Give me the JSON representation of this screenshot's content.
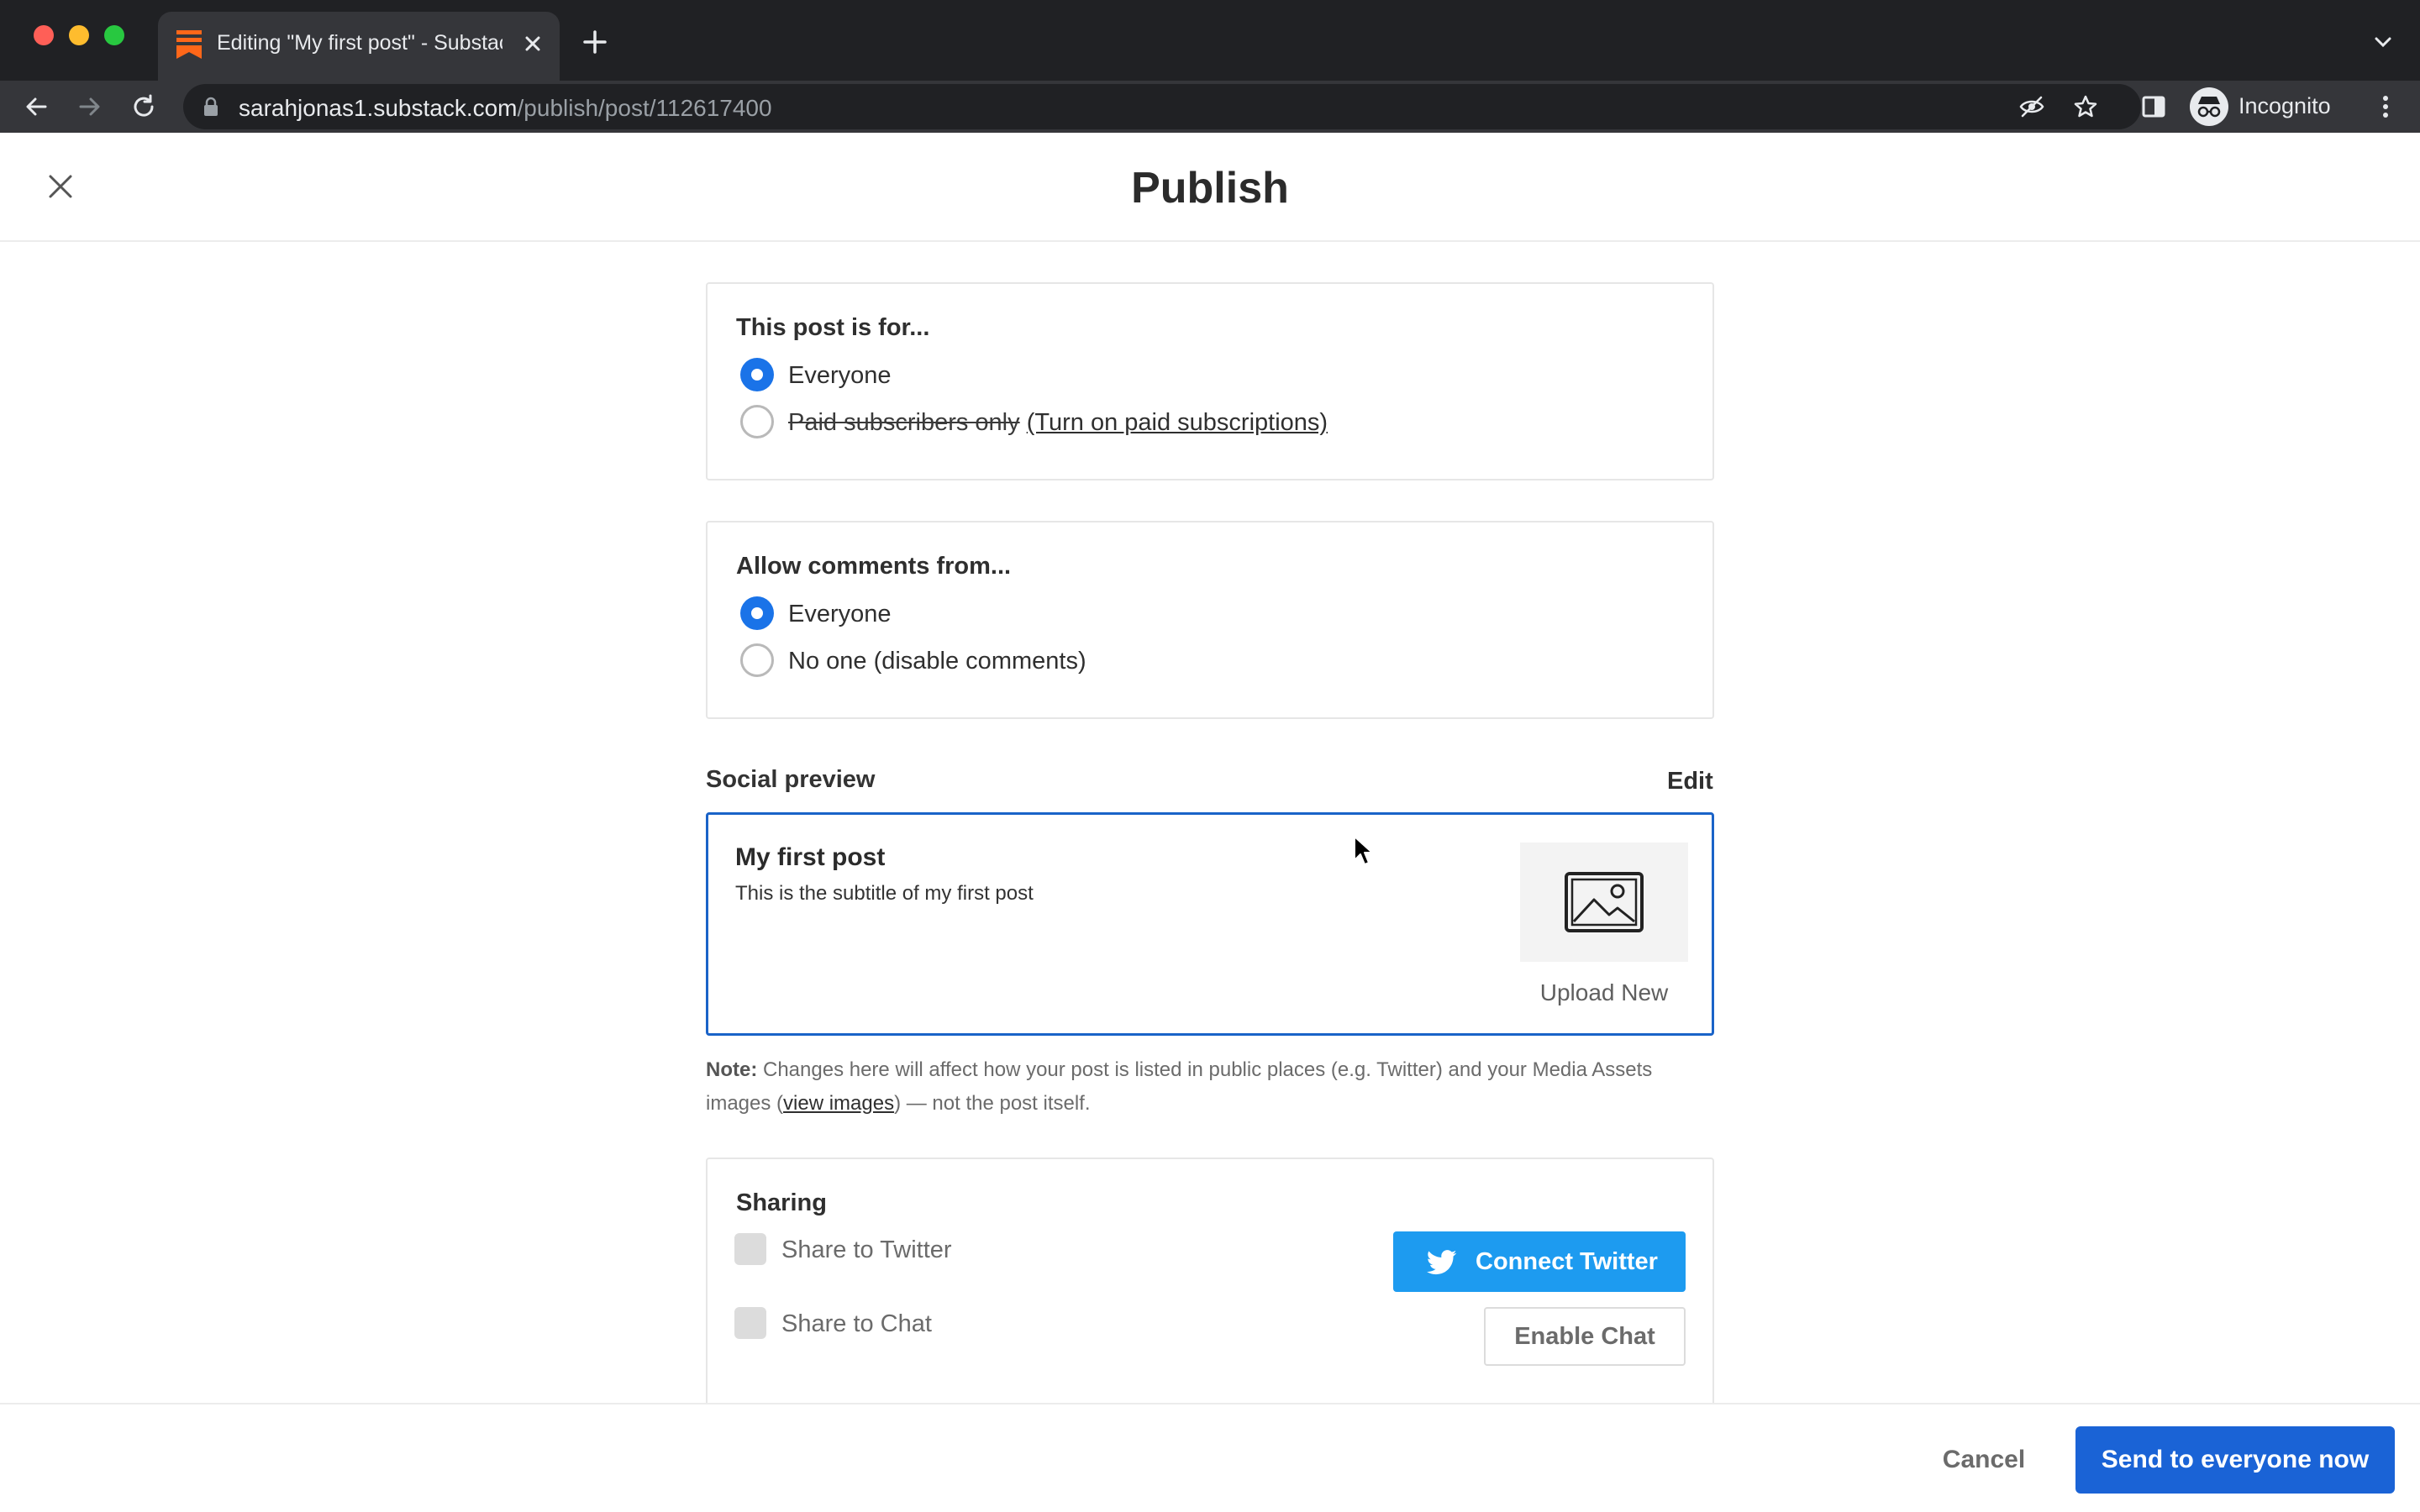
{
  "browser": {
    "tab_title": "Editing \"My first post\" - Substack",
    "url_host": "sarahjonas1.substack.com",
    "url_path": "/publish/post/112617400",
    "profile_label": "Incognito"
  },
  "header": {
    "title": "Publish"
  },
  "audience": {
    "label": "This post is for...",
    "options": [
      {
        "label": "Everyone",
        "selected": true
      },
      {
        "label": "Paid subscribers only",
        "link": "(Turn on paid subscriptions)",
        "selected": false
      }
    ]
  },
  "comments": {
    "label": "Allow comments from...",
    "options": [
      {
        "label": "Everyone",
        "selected": true
      },
      {
        "label": "No one (disable comments)",
        "selected": false
      }
    ]
  },
  "social_preview": {
    "section_title": "Social preview",
    "edit_label": "Edit",
    "post_title": "My first post",
    "post_subtitle": "This is the subtitle of my first post",
    "upload_label": "Upload New"
  },
  "note": {
    "prefix": "Note:",
    "text_before": " Changes here will affect how your post is listed in public places (e.g. Twitter) and your Media Assets images (",
    "link": "view images",
    "text_after": ") — not the post itself."
  },
  "sharing": {
    "title": "Sharing",
    "twitter_label": "Share to Twitter",
    "chat_label": "Share to Chat",
    "connect_twitter": "Connect Twitter",
    "enable_chat": "Enable Chat"
  },
  "footer": {
    "cancel": "Cancel",
    "send": "Send to everyone now"
  },
  "colors": {
    "accent": "#1a73e8",
    "twitter": "#1d9bf0",
    "substack": "#ff6719"
  }
}
